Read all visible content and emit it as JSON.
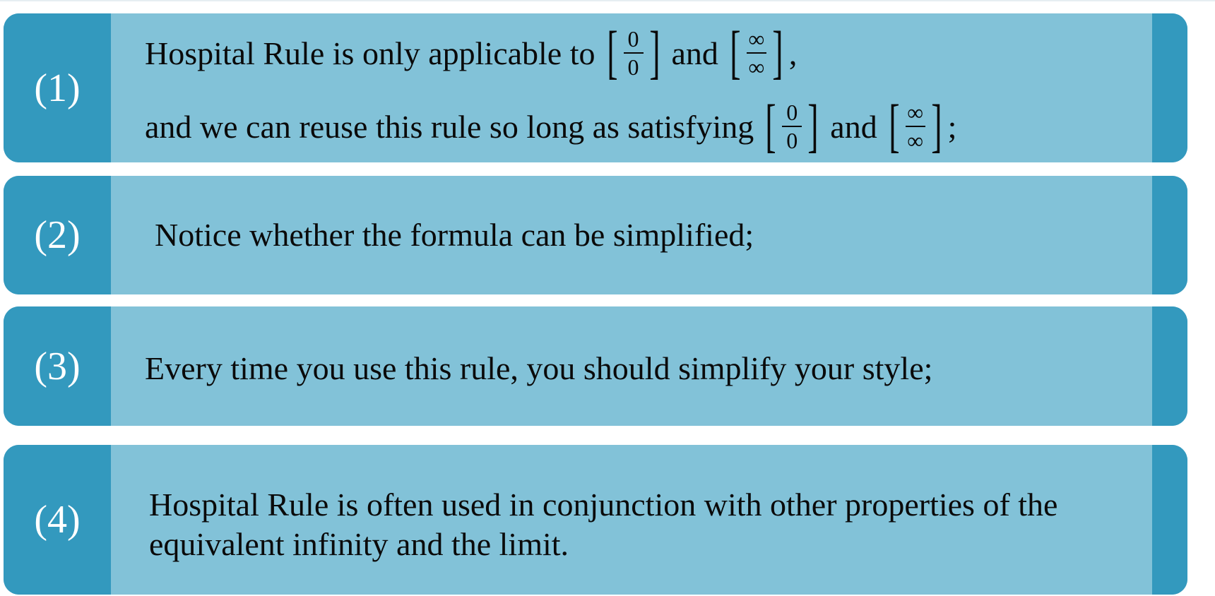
{
  "rows": [
    {
      "number": "(1)",
      "line1": {
        "pre": "Hospital Rule is only applicable to",
        "frac1": {
          "num": "0",
          "den": "0"
        },
        "mid": "and",
        "frac2": {
          "num": "∞",
          "den": "∞"
        },
        "post": ","
      },
      "line2": {
        "pre": "and we can reuse this rule so long as satisfying",
        "frac1": {
          "num": "0",
          "den": "0"
        },
        "mid": "and",
        "frac2": {
          "num": "∞",
          "den": "∞"
        },
        "post": ";"
      }
    },
    {
      "number": "(2)",
      "text": "Notice whether the formula can be simplified;"
    },
    {
      "number": "(3)",
      "text": "Every time you use this rule, you should simplify your style;"
    },
    {
      "number": "(4)",
      "line1": "Hospital Rule is often used in conjunction with other properties of the",
      "line2": "equivalent infinity and the limit."
    }
  ],
  "colors": {
    "accent": "#3399be",
    "panel": "#82c2d8",
    "number_text": "#ffffff",
    "body_text": "#0a0a0a"
  }
}
